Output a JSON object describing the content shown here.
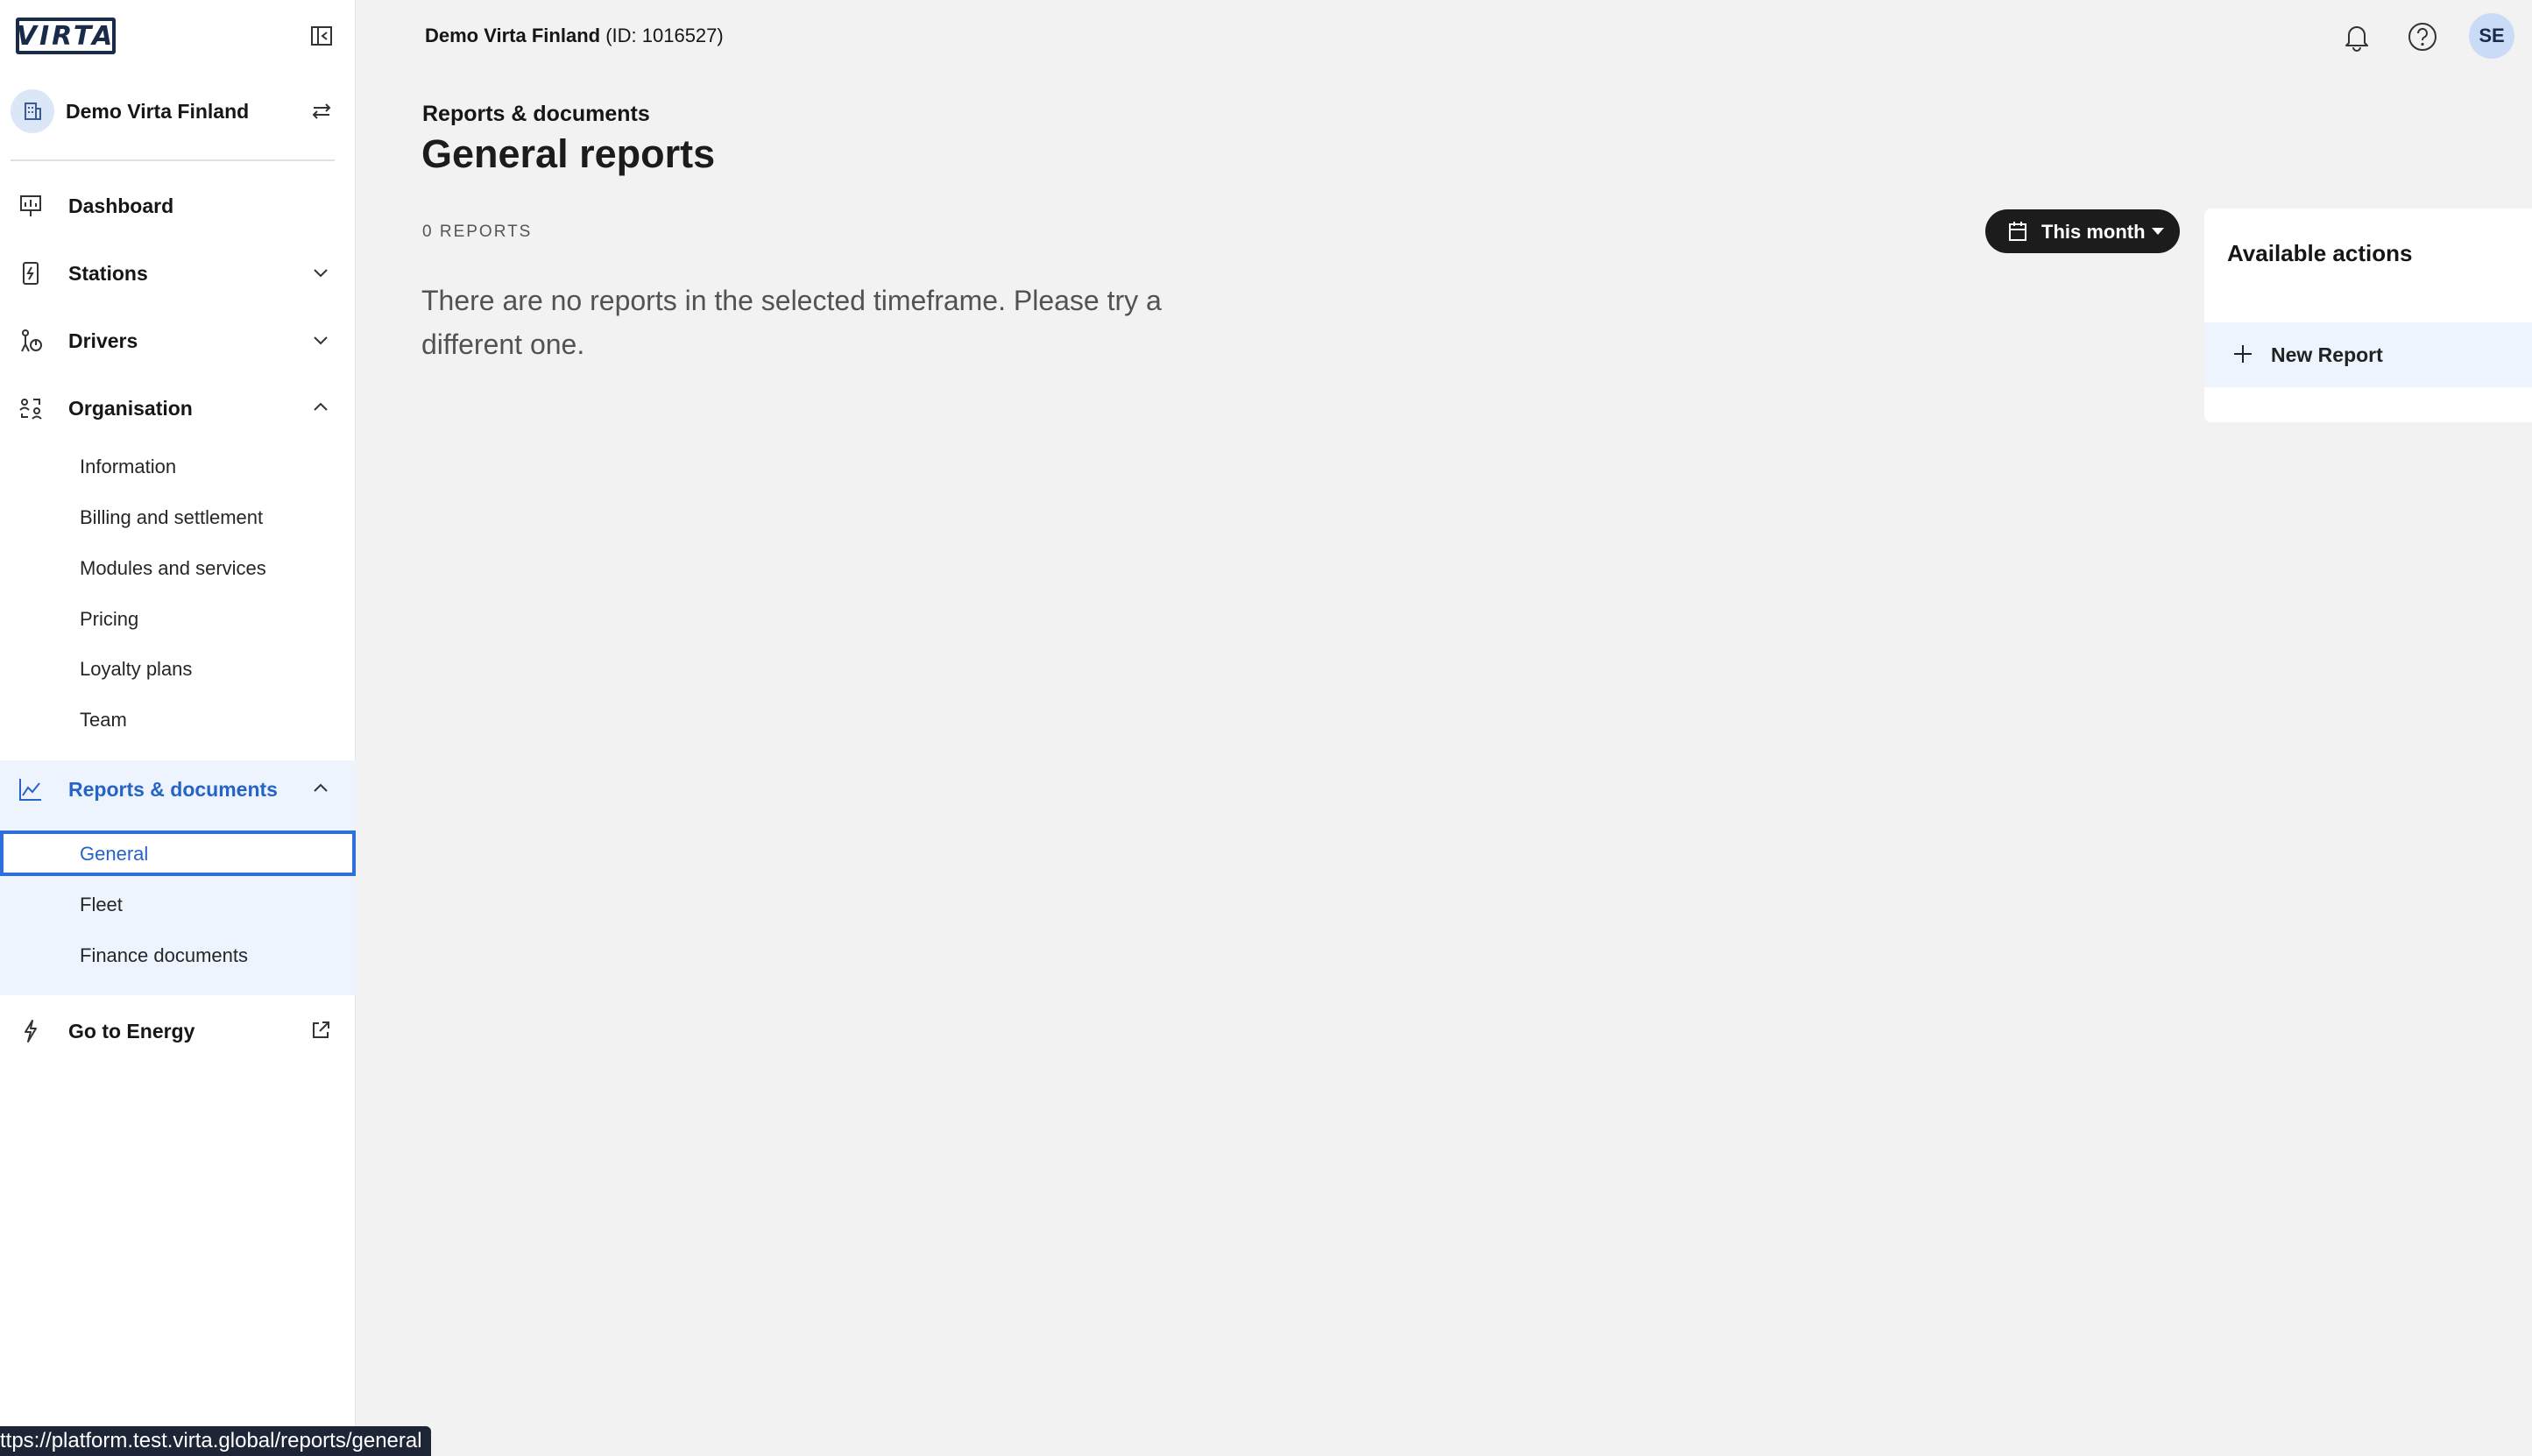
{
  "sidebar": {
    "logo_text": "VIRTA",
    "org_name": "Demo Virta Finland",
    "nav": {
      "dashboard": "Dashboard",
      "stations": "Stations",
      "drivers": "Drivers",
      "organisation": "Organisation",
      "reports": "Reports & documents",
      "energy": "Go to Energy"
    },
    "organisation_items": [
      "Information",
      "Billing and settlement",
      "Modules and services",
      "Pricing",
      "Loyalty plans",
      "Team"
    ],
    "reports_items": [
      "General",
      "Fleet",
      "Finance documents"
    ]
  },
  "header": {
    "org_name": "Demo Virta Finland",
    "org_id": "(ID: 1016527)",
    "avatar_initials": "SE"
  },
  "main": {
    "breadcrumb": "Reports & documents",
    "title": "General reports",
    "count": "0 REPORTS",
    "empty_message": "There are no reports in the selected timeframe. Please try a different one.",
    "timeframe_label": "This month"
  },
  "actions": {
    "title": "Available actions",
    "new_report": "New Report"
  },
  "statusbar": {
    "url": "ttps://platform.test.virta.global/reports/general"
  },
  "colors": {
    "accent": "#2563c9",
    "active_bg": "#edf4fe",
    "dark_button": "#1c1c1c"
  }
}
